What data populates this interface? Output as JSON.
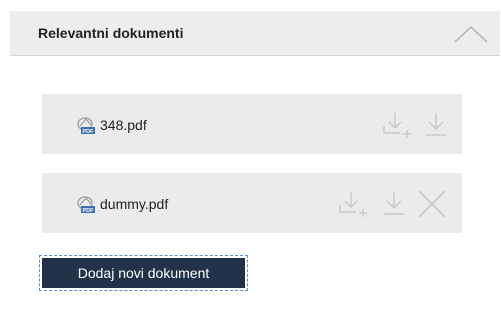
{
  "section": {
    "title": "Relevantni dokumenti",
    "collapse_icon": "chevron-up-icon"
  },
  "documents": [
    {
      "name": "348.pdf",
      "file_icon": "pdf-file-icon",
      "actions": [
        "add-to-list-icon",
        "download-icon"
      ]
    },
    {
      "name": "dummy.pdf",
      "file_icon": "pdf-file-icon",
      "actions": [
        "add-to-list-icon",
        "download-icon",
        "close-icon"
      ]
    }
  ],
  "add_button_label": "Dodaj novi dokument",
  "colors": {
    "header_bg": "#ededee",
    "row_bg": "#ebebeb",
    "button_bg": "#22324b",
    "icon_gray": "#c7c7c7"
  }
}
